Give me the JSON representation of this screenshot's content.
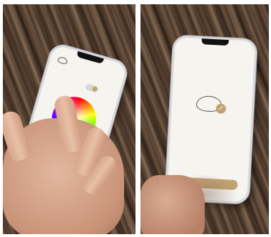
{
  "photos": [
    {
      "id": "left",
      "scene": "hand-touching-color-wheel",
      "accent_color": "#c5a46a"
    },
    {
      "id": "right",
      "scene": "phone-confirmation-screen",
      "accent_color": "#c3a373"
    }
  ]
}
